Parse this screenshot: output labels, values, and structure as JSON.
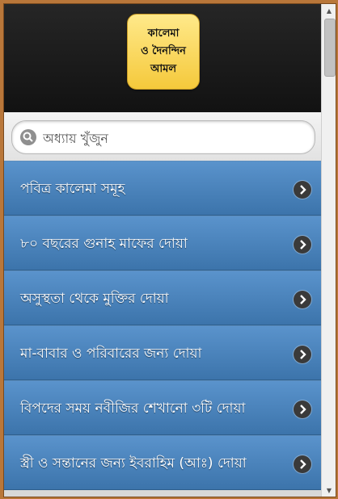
{
  "app": {
    "logo_text": "কালেমা\nও দৈনন্দিন\nআমল"
  },
  "search": {
    "placeholder": "অধ্যায় খুঁজুন",
    "icon": "search-icon"
  },
  "list": {
    "items": [
      {
        "label": "পবিত্র কালেমা সমূহ"
      },
      {
        "label": "৮০ বছরের গুনাহ মাফের দোয়া"
      },
      {
        "label": "অসুস্থতা থেকে মুক্তির দোয়া"
      },
      {
        "label": "মা-বাবার ও পরিবারের জন্য দোয়া"
      },
      {
        "label": "বিপদের সময় নবীজির শেখানো ৩টি দোয়া"
      },
      {
        "label": "স্ত্রী ও সন্তানের জন্য ইবরাহিম (আঃ) দোয়া"
      }
    ]
  },
  "colors": {
    "header_bg": "#1a1a1a",
    "logo_bg": "#f7d04a",
    "list_item_bg": "#4a82ba",
    "frame_border": "#b9773a"
  }
}
